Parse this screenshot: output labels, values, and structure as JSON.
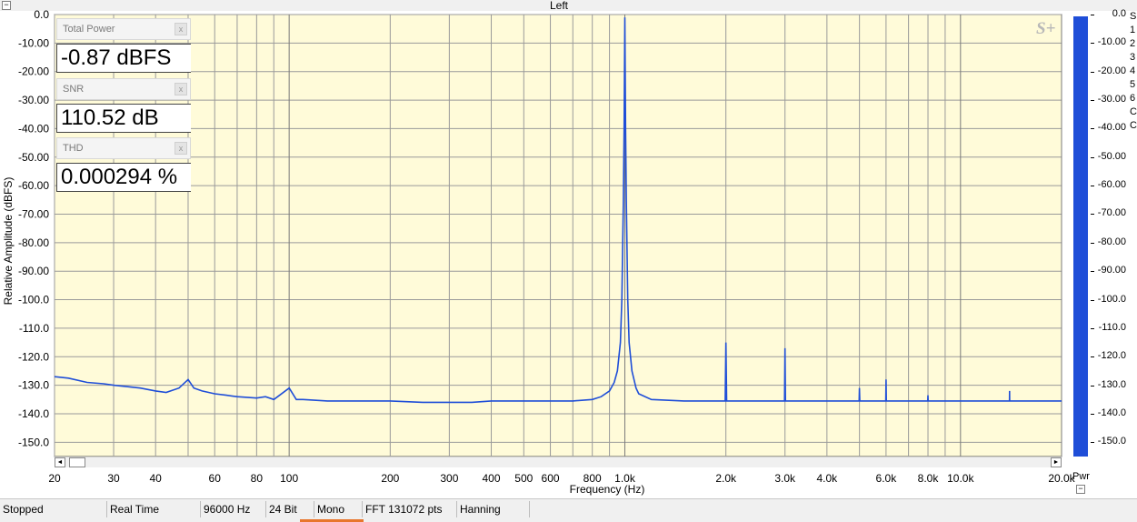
{
  "window": {
    "chart_title": "Left",
    "min_glyph": "−",
    "logo": "S+"
  },
  "panels": [
    {
      "title": "Total Power",
      "value": "-0.87 dBFS",
      "close": "x"
    },
    {
      "title": "SNR",
      "value": "110.52 dB",
      "close": "x"
    },
    {
      "title": "THD",
      "value": "0.000294 %",
      "close": "x"
    }
  ],
  "right_meter": {
    "label": "Pwr",
    "ticks": [
      "0.0",
      "-10.00",
      "-20.00",
      "-30.00",
      "-40.00",
      "-50.00",
      "-60.00",
      "-70.00",
      "-80.00",
      "-90.00",
      "-100.0",
      "-110.0",
      "-120.0",
      "-130.0",
      "-140.0",
      "-150.0"
    ],
    "side_chars": [
      "S",
      "1",
      "2",
      "3",
      "4",
      "5",
      "6",
      "C",
      "C"
    ],
    "level_db": 0,
    "color": "#1f4ed8"
  },
  "scrollbar": {
    "left_arrow": "◄",
    "right_arrow": "►"
  },
  "status_bar": [
    "Stopped",
    "Real Time",
    "96000 Hz",
    "24 Bit",
    "Mono",
    "FFT 131072 pts",
    "Hanning"
  ],
  "colors": {
    "plot_bg": "#fffbd9",
    "trace": "#1f4ed8",
    "grid": "#9a9a9a"
  },
  "chart_data": {
    "type": "line",
    "title": "Left",
    "xlabel": "Frequency (Hz)",
    "ylabel": "Relative Amplitude (dBFS)",
    "x_scale": "log",
    "xlim": [
      20,
      20000
    ],
    "ylim": [
      -155,
      0
    ],
    "grid": true,
    "y_ticks": [
      0,
      -10,
      -20,
      -30,
      -40,
      -50,
      -60,
      -70,
      -80,
      -90,
      -100,
      -110,
      -120,
      -130,
      -140,
      -150
    ],
    "y_tick_labels": [
      "0.0",
      "-10.00",
      "-20.00",
      "-30.00",
      "-40.00",
      "-50.00",
      "-60.00",
      "-70.00",
      "-80.00",
      "-90.00",
      "-100.0",
      "-110.0",
      "-120.0",
      "-130.0",
      "-140.0",
      "-150.0"
    ],
    "x_ticks": [
      20,
      30,
      40,
      60,
      80,
      100,
      200,
      300,
      400,
      500,
      600,
      800,
      1000,
      2000,
      3000,
      4000,
      6000,
      8000,
      10000,
      20000
    ],
    "x_tick_labels": [
      "20",
      "30",
      "40",
      "60",
      "80",
      "100",
      "200",
      "300",
      "400",
      "500",
      "600",
      "800",
      "1.0k",
      "2.0k",
      "3.0k",
      "4.0k",
      "6.0k",
      "8.0k",
      "10.0k",
      "20.0k"
    ],
    "series": [
      {
        "x": [
          20,
          22,
          25,
          28,
          30,
          33,
          36,
          40,
          43,
          47,
          50,
          52,
          55,
          60,
          65,
          70,
          80,
          85,
          90,
          100,
          105,
          110,
          130,
          150,
          170,
          200,
          250,
          300,
          350,
          400,
          500,
          600,
          700,
          800,
          850,
          900,
          930,
          950,
          970,
          980,
          990,
          995,
          1000,
          1005,
          1010,
          1020,
          1030,
          1050,
          1080,
          1100,
          1200,
          1500,
          1800,
          1990,
          2000,
          2010,
          2200,
          2500,
          2900,
          2990,
          3000,
          3010,
          3500,
          4000,
          4500,
          4900,
          4990,
          5000,
          5010,
          5500,
          5900,
          5990,
          6000,
          6010,
          6500,
          7000,
          7500,
          7900,
          7990,
          8000,
          8010,
          9000,
          10000,
          12000,
          13900,
          13990,
          14000,
          14010,
          15000,
          17000,
          20000
        ],
        "y": [
          -127,
          -127.5,
          -129,
          -129.5,
          -130,
          -130.5,
          -131,
          -132,
          -132.5,
          -131,
          -128,
          -131,
          -132,
          -133,
          -133.5,
          -134,
          -134.5,
          -134,
          -135,
          -131,
          -135,
          -135,
          -135.5,
          -135.5,
          -135.5,
          -135.5,
          -136,
          -136,
          -136,
          -135.5,
          -135.5,
          -135.5,
          -135.5,
          -135,
          -134,
          -132,
          -129,
          -125,
          -115,
          -100,
          -65,
          -40,
          -1,
          -40,
          -65,
          -100,
          -115,
          -125,
          -131,
          -133,
          -135,
          -135.5,
          -135.5,
          -135.5,
          -115,
          -135.5,
          -135.5,
          -135.5,
          -135.5,
          -135.5,
          -117,
          -135.5,
          -135.5,
          -135.5,
          -135.5,
          -135.5,
          -135.5,
          -131,
          -135.5,
          -135.5,
          -135.5,
          -135.5,
          -128,
          -135.5,
          -135.5,
          -135.5,
          -135.5,
          -135.5,
          -135.5,
          -133.5,
          -135.5,
          -135.5,
          -135.5,
          -135.5,
          -135.5,
          -135.5,
          -132,
          -135.5,
          -135.5,
          -135.5,
          -135.5
        ]
      }
    ]
  }
}
